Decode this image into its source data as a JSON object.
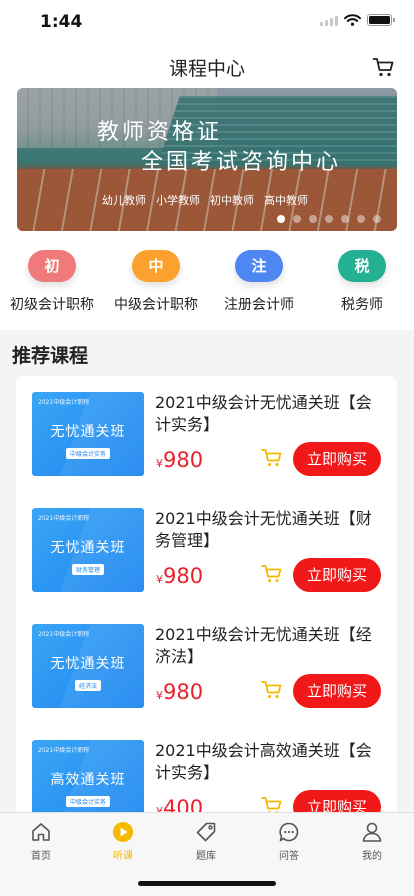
{
  "status_bar": {
    "time": "1:44"
  },
  "nav": {
    "title": "课程中心"
  },
  "banner": {
    "title_line1": "教师资格证",
    "title_line2": "全国考试咨询中心",
    "tags": [
      "幼儿教师",
      "小学教师",
      "初中教师",
      "高中教师"
    ],
    "page_count": 7,
    "active_page": 1
  },
  "categories": [
    {
      "badge": "初",
      "label": "初级会计职称",
      "color": "#f07a7a"
    },
    {
      "badge": "中",
      "label": "中级会计职称",
      "color": "#fca02e"
    },
    {
      "badge": "注",
      "label": "注册会计师",
      "color": "#4e86f2"
    },
    {
      "badge": "税",
      "label": "税务师",
      "color": "#23b093"
    }
  ],
  "recommended": {
    "title": "推荐课程",
    "courses": [
      {
        "thumb_top": "2021中级会计职称",
        "thumb_main": "无忧通关班",
        "thumb_tag": "中级会计实务",
        "name": "2021中级会计无忧通关班【会计实务】",
        "price_symbol": "¥",
        "price": "980",
        "buy_label": "立即购买"
      },
      {
        "thumb_top": "2021中级会计职称",
        "thumb_main": "无忧通关班",
        "thumb_tag": "财务管理",
        "name": "2021中级会计无忧通关班【财务管理】",
        "price_symbol": "¥",
        "price": "980",
        "buy_label": "立即购买"
      },
      {
        "thumb_top": "2021中级会计职称",
        "thumb_main": "无忧通关班",
        "thumb_tag": "经济法",
        "name": "2021中级会计无忧通关班【经济法】",
        "price_symbol": "¥",
        "price": "980",
        "buy_label": "立即购买"
      },
      {
        "thumb_top": "2021中级会计职称",
        "thumb_main": "高效通关班",
        "thumb_tag": "中级会计实务",
        "name": "2021中级会计高效通关班【会计实务】",
        "price_symbol": "¥",
        "price": "400",
        "buy_label": "立即购买"
      }
    ]
  },
  "tab_bar": {
    "active_index": 1,
    "active_color": "#f6b900",
    "tabs": [
      {
        "label": "首页",
        "icon": "home-icon"
      },
      {
        "label": "听课",
        "icon": "play-icon"
      },
      {
        "label": "题库",
        "icon": "tag-icon"
      },
      {
        "label": "问答",
        "icon": "chat-icon"
      },
      {
        "label": "我的",
        "icon": "user-icon"
      }
    ]
  }
}
